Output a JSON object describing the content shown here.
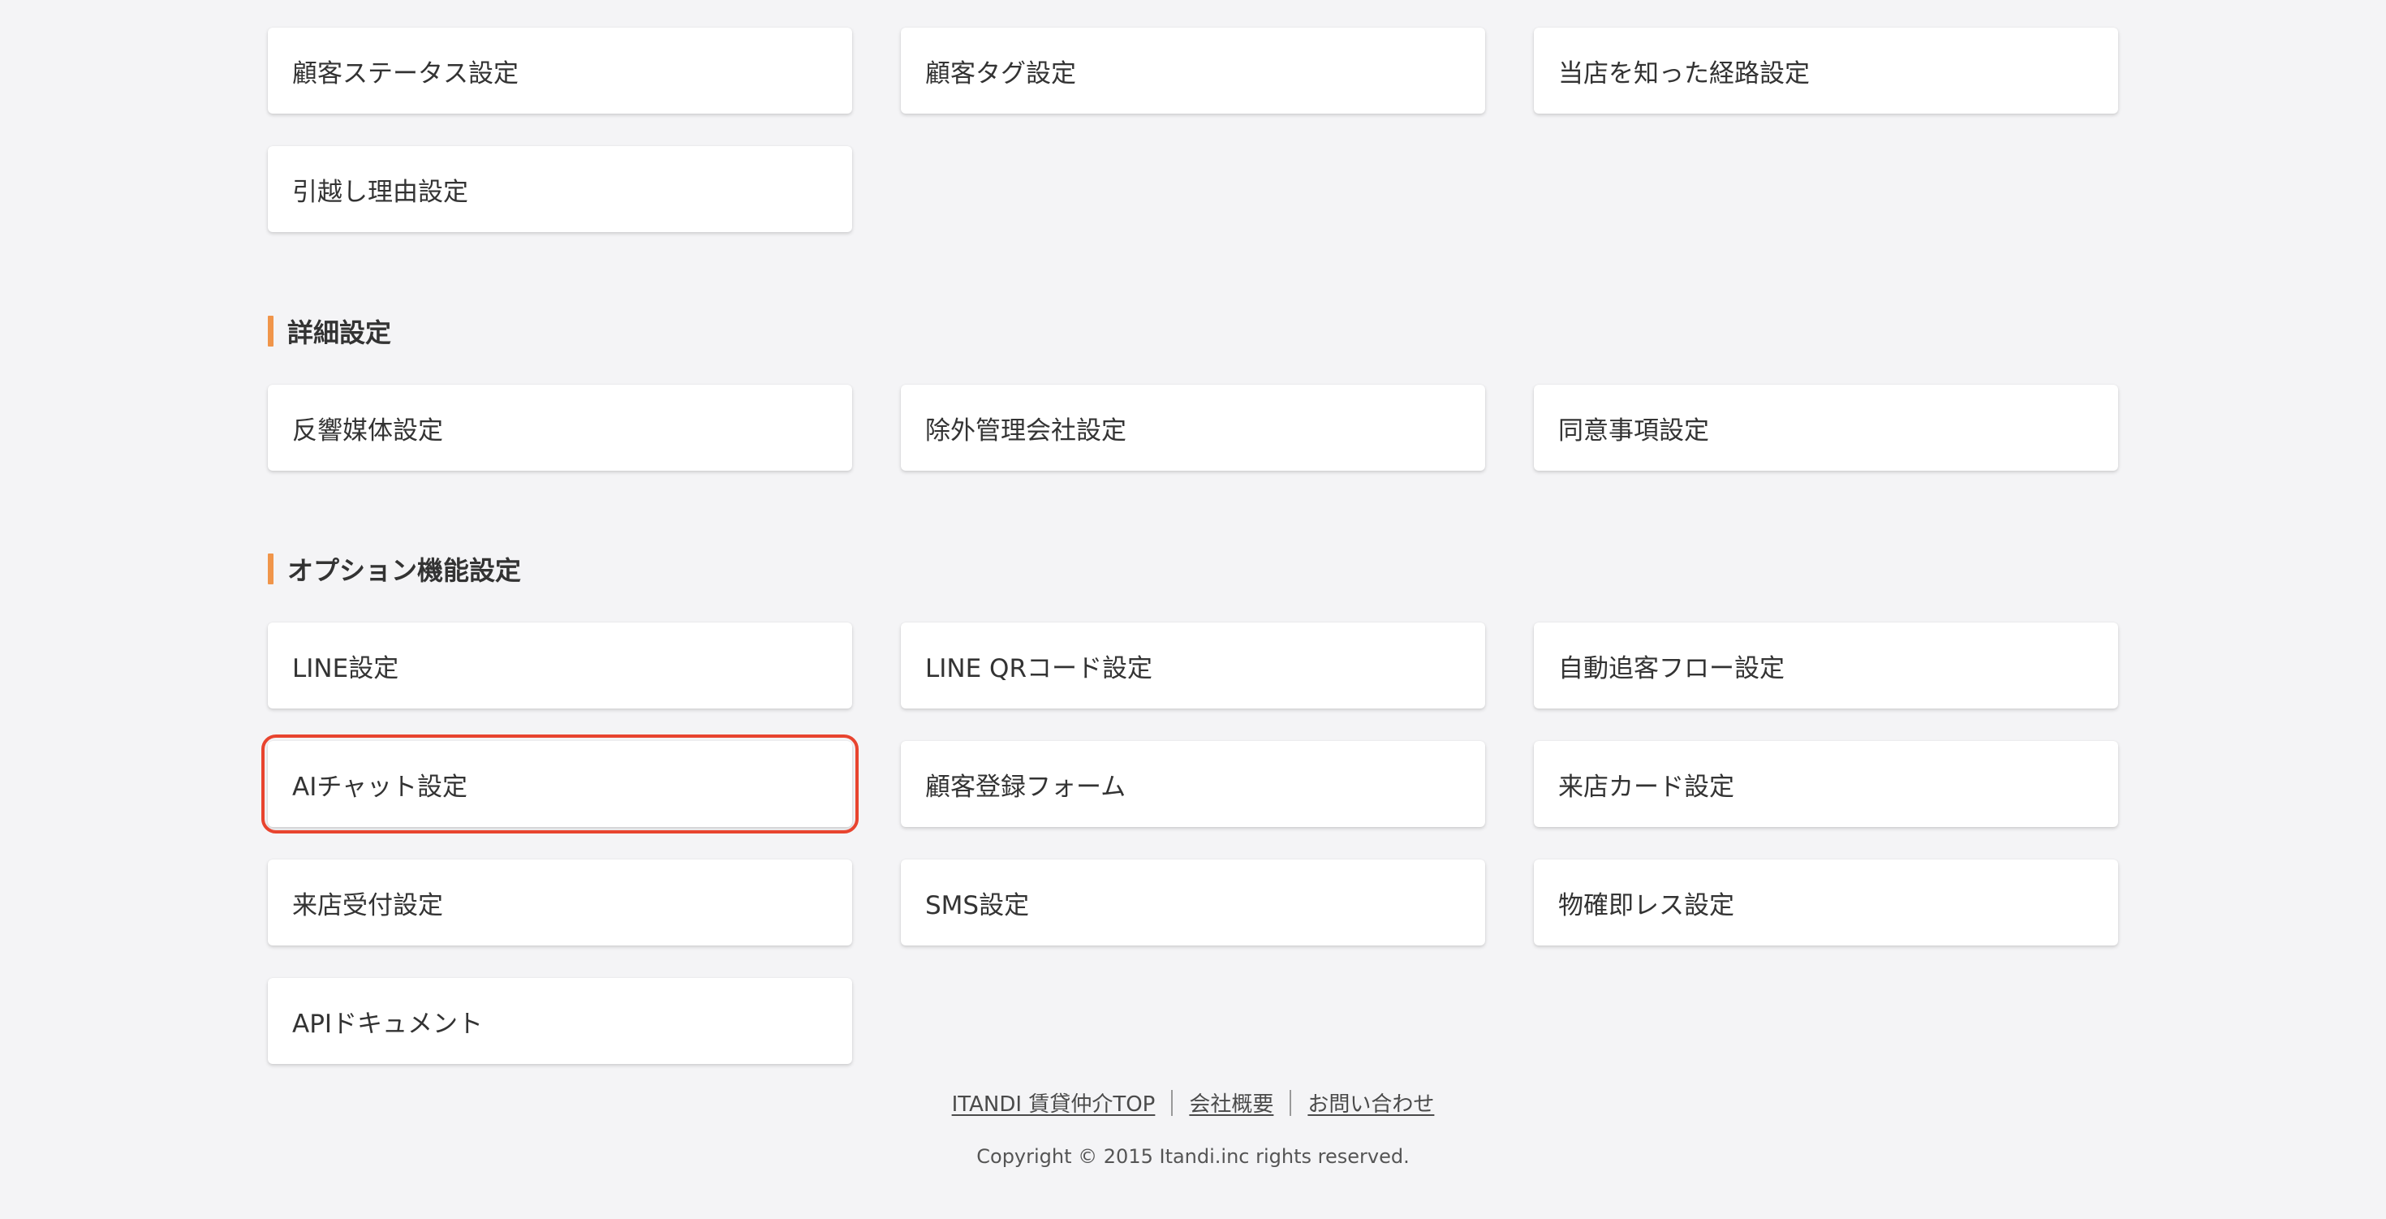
{
  "sections": [
    {
      "heading": "",
      "items": [
        "顧客ステータス設定",
        "顧客タグ設定",
        "当店を知った経路設定",
        "引越し理由設定"
      ]
    },
    {
      "heading": "詳細設定",
      "items": [
        "反響媒体設定",
        "除外管理会社設定",
        "同意事項設定"
      ]
    },
    {
      "heading": "オプション機能設定",
      "items": [
        "LINE設定",
        "LINE QRコード設定",
        "自動追客フロー設定",
        "AIチャット設定",
        "顧客登録フォーム",
        "来店カード設定",
        "来店受付設定",
        "SMS設定",
        "物確即レス設定",
        "APIドキュメント"
      ]
    }
  ],
  "footer": {
    "links": [
      "ITANDI 賃貸仲介TOP",
      "会社概要",
      "お問い合わせ"
    ],
    "copyright": "Copyright © 2015 Itandi.inc rights reserved."
  },
  "colors": {
    "accent_bar": "#f0954a",
    "highlight_border": "#e8442f",
    "background": "#f4f4f6"
  }
}
